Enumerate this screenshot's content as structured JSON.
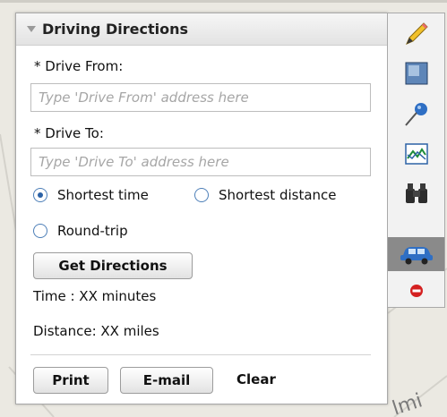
{
  "panel": {
    "title": "Driving Directions",
    "from_label": "* Drive From:",
    "from_placeholder": "Type 'Drive From' address here",
    "to_label": "* Drive To:",
    "to_placeholder": "Type 'Drive To' address here"
  },
  "options": {
    "shortest_time": "Shortest time",
    "shortest_distance": "Shortest distance",
    "round_trip": "Round-trip",
    "selected": "Shortest time"
  },
  "actions": {
    "get_directions": "Get Directions",
    "print": "Print",
    "email": "E-mail",
    "clear": "Clear"
  },
  "results": {
    "time": "Time : XX minutes",
    "distance": "Distance: XX miles"
  },
  "map": {
    "label_fragment": "lmi"
  },
  "toolbar": {
    "tools": [
      "pencil-icon",
      "rectangle-select-icon",
      "pushpin-icon",
      "chart-icon",
      "binoculars-icon",
      "car-icon",
      "remove-icon"
    ],
    "active_tool": "car-icon"
  },
  "colors": {
    "radio_accent": "#2c62a6",
    "active_tool_bg": "#8a8a8a"
  }
}
